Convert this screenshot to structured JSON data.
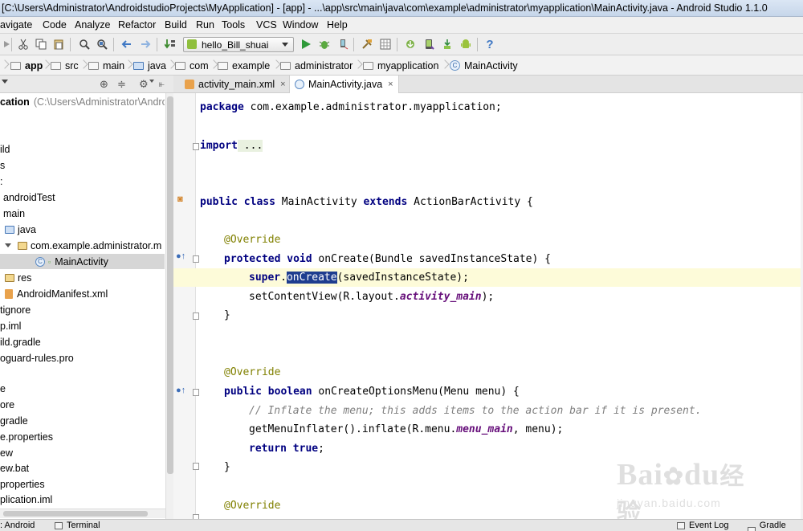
{
  "window": {
    "title": "[C:\\Users\\Administrator\\AndroidstudioProjects\\MyApplication] - [app] - ...\\app\\src\\main\\java\\com\\example\\administrator\\myapplication\\MainActivity.java - Android Studio 1.1.0"
  },
  "menu": [
    "avigate",
    "Code",
    "Analyze",
    "Refactor",
    "Build",
    "Run",
    "Tools",
    "VCS",
    "Window",
    "Help"
  ],
  "toolbar": {
    "run_config": "hello_Bill_shuai",
    "help_glyph": "?"
  },
  "breadcrumb": [
    "app",
    "src",
    "main",
    "java",
    "com",
    "example",
    "administrator",
    "myapplication",
    "MainActivity"
  ],
  "project_panel": {
    "root_label": "cation",
    "root_path": "(C:\\Users\\Administrator\\Andro",
    "rows": [
      "ild",
      "s",
      "",
      "androidTest",
      "main",
      "java",
      "com.example.administrator.m",
      "MainActivity",
      "res",
      "AndroidManifest.xml",
      "tignore",
      "p.iml",
      "ild.gradle",
      "oguard-rules.pro",
      "",
      "e",
      "ore",
      "gradle",
      "e.properties",
      "ew",
      "ew.bat",
      "properties",
      "plication.iml"
    ]
  },
  "tabs": [
    {
      "label": "activity_main.xml",
      "close": "×",
      "active": false
    },
    {
      "label": "MainActivity.java",
      "close": "×",
      "active": true
    }
  ],
  "code": {
    "l1_kw": "package",
    "l1_rest": " com.example.administrator.myapplication;",
    "l2_kw": "import",
    "l2_rest": " ...",
    "l3_kw": "public class",
    "l3_name": " MainActivity ",
    "l3_kw2": "extends",
    "l3_rest": " ActionBarActivity {",
    "override": "@Override",
    "l5_kw": "protected void",
    "l5_rest": " onCreate(Bundle savedInstanceState) {",
    "l6_kw": "super",
    "l6_dot": ".",
    "l6_hl": "onCreate",
    "l6_rest": "(savedInstanceState);",
    "l7_a": "setContentView(R.layout.",
    "l7_fld": "activity_main",
    "l7_b": ");",
    "brace": "}",
    "l10_kw": "public boolean",
    "l10_rest": " onCreateOptionsMenu(Menu menu) {",
    "l11_comment": "// Inflate the menu; this adds items to the action bar if it is present.",
    "l12_a": "getMenuInflater().inflate(R.menu.",
    "l12_fld": "menu_main",
    "l12_b": ", menu);",
    "l13_kw": "return true",
    "l13_rest": ";"
  },
  "status_bar": {
    "android": ": Android",
    "terminal": "Terminal",
    "event_log": "Event Log",
    "gradle": "Gradle Con"
  },
  "watermark": {
    "main": "Bai",
    "mid": "du",
    "cn": "经验",
    "sub": "jingyan.baidu.com"
  }
}
